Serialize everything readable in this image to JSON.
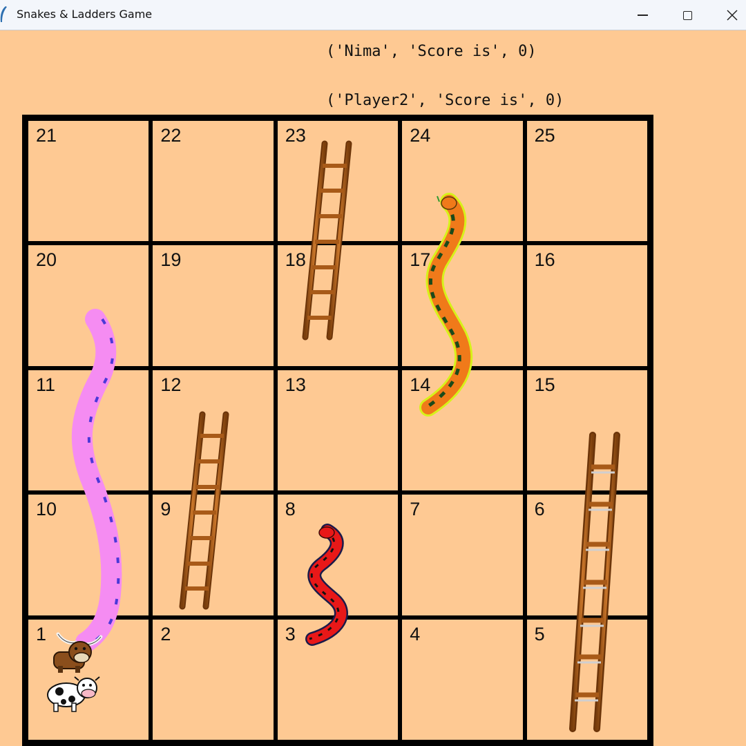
{
  "window": {
    "title": "Snakes & Ladders Game",
    "controls": [
      "minimize",
      "maximize",
      "close"
    ]
  },
  "scores": [
    {
      "text": "('Nima', 'Score is', 0)"
    },
    {
      "text": "('Player2', 'Score is', 0)"
    }
  ],
  "board": {
    "rows": [
      [
        "21",
        "22",
        "23",
        "24",
        "25"
      ],
      [
        "20",
        "19",
        "18",
        "17",
        "16"
      ],
      [
        "11",
        "12",
        "13",
        "14",
        "15"
      ],
      [
        "10",
        "9",
        "8",
        "7",
        "6"
      ],
      [
        "1",
        "2",
        "3",
        "4",
        "5"
      ]
    ],
    "ladders": [
      {
        "from": "9",
        "to": "12"
      },
      {
        "from": "18",
        "to": "23"
      },
      {
        "from": "5",
        "to": "15"
      }
    ],
    "snakes": [
      {
        "head": "24",
        "tail": "14",
        "color": "#f07a1a"
      },
      {
        "head": "8",
        "tail": "3",
        "color": "#e81818"
      },
      {
        "head": "20",
        "tail": "1",
        "color": "#f58cf2"
      }
    ],
    "pieces": [
      {
        "name": "bull-piece",
        "cell": "1"
      },
      {
        "name": "cow-piece",
        "cell": "1"
      }
    ]
  },
  "colors": {
    "background": "#fec993",
    "grid": "#000000",
    "ladder": "#b8661c"
  }
}
